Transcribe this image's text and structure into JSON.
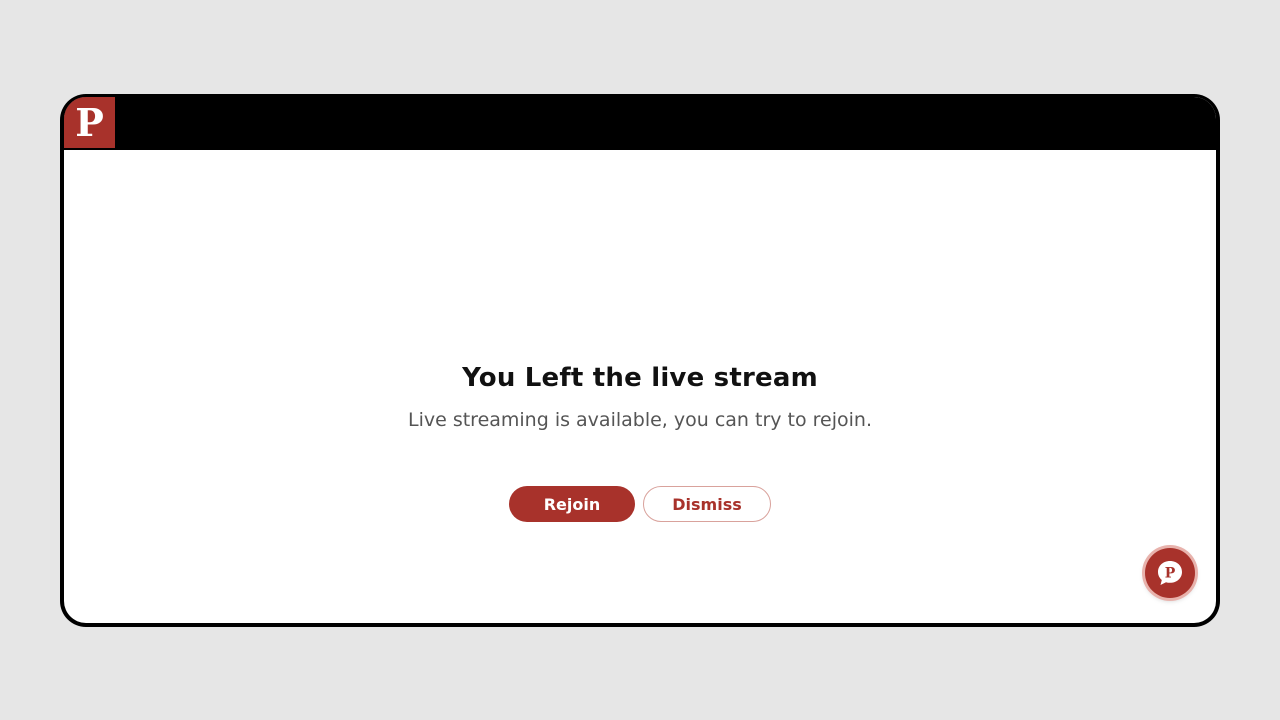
{
  "app": {
    "logo_letter": "P",
    "brand_color": "#a8322b"
  },
  "dialog": {
    "title": "You Left the live stream",
    "message": "Live streaming is available, you can try to rejoin.",
    "rejoin_label": "Rejoin",
    "dismiss_label": "Dismiss"
  },
  "chat_widget": {
    "icon": "chat-bubble-icon",
    "letter": "P"
  }
}
